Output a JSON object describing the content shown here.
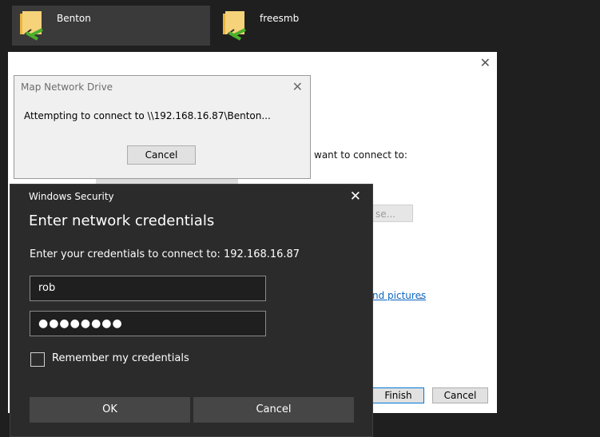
{
  "folders": [
    {
      "name": "Benton",
      "selected": true
    },
    {
      "name": "freesmb",
      "selected": false
    }
  ],
  "wizard": {
    "close_glyph": "✕",
    "prompt_fragment": "want to connect to:",
    "browse_fragment": "se...",
    "link_fragment": "nd pictures",
    "link_trailing": ".",
    "finish_label": "Finish",
    "cancel_label": "Cancel"
  },
  "map_network_drive": {
    "title": "Map Network Drive",
    "close_glyph": "✕",
    "message": "Attempting to connect to \\\\192.168.16.87\\Benton...",
    "cancel_label": "Cancel"
  },
  "windows_security": {
    "title": "Windows Security",
    "close_glyph": "✕",
    "heading": "Enter network credentials",
    "prompt": "Enter your credentials to connect to: 192.168.16.87",
    "username_value": "rob",
    "password_masked": "●●●●●●●●",
    "remember_label": "Remember my credentials",
    "remember_checked": false,
    "ok_label": "OK",
    "cancel_label": "Cancel"
  },
  "colors": {
    "folder": "#f2c04a",
    "network_cable": "#4caf2a",
    "link": "#0b64c0",
    "dark_bg": "#1f1f1f",
    "dialog_dark": "#2b2b2b"
  },
  "icons": [
    "network-folder-icon",
    "close-icon"
  ]
}
